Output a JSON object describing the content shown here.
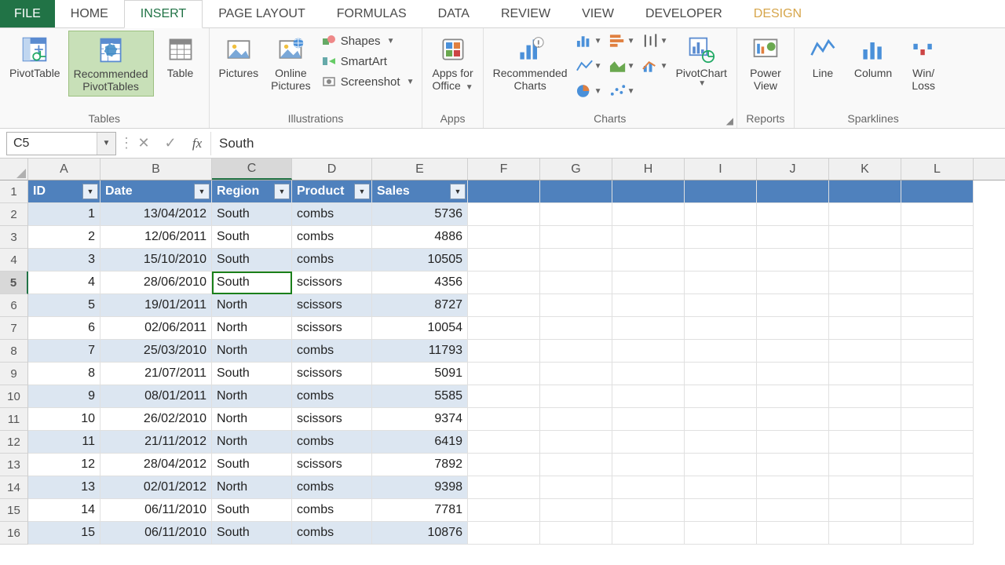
{
  "tabs": {
    "file": "FILE",
    "home": "HOME",
    "insert": "INSERT",
    "page_layout": "PAGE LAYOUT",
    "formulas": "FORMULAS",
    "data": "DATA",
    "review": "REVIEW",
    "view": "VIEW",
    "developer": "DEVELOPER",
    "design": "DESIGN"
  },
  "ribbon": {
    "tables": {
      "label": "Tables",
      "pivottable": "PivotTable",
      "recommended_pt_l1": "Recommended",
      "recommended_pt_l2": "PivotTables",
      "table": "Table"
    },
    "illustrations": {
      "label": "Illustrations",
      "pictures": "Pictures",
      "online_pictures_l1": "Online",
      "online_pictures_l2": "Pictures",
      "shapes": "Shapes",
      "smartart": "SmartArt",
      "screenshot": "Screenshot"
    },
    "apps": {
      "label": "Apps",
      "apps_for_office_l1": "Apps for",
      "apps_for_office_l2": "Office"
    },
    "charts": {
      "label": "Charts",
      "recommended_l1": "Recommended",
      "recommended_l2": "Charts",
      "pivotchart": "PivotChart"
    },
    "reports": {
      "label": "Reports",
      "power_view_l1": "Power",
      "power_view_l2": "View"
    },
    "sparklines": {
      "label": "Sparklines",
      "line": "Line",
      "column": "Column",
      "winloss_l1": "Win/",
      "winloss_l2": "Loss"
    }
  },
  "formula_bar": {
    "namebox": "C5",
    "value": "South"
  },
  "grid": {
    "columns": [
      "A",
      "B",
      "C",
      "D",
      "E",
      "F",
      "G",
      "H",
      "I",
      "J",
      "K",
      "L"
    ],
    "selected_col": "C",
    "selected_row": 5,
    "widths": [
      "cA",
      "cB",
      "cC",
      "cD",
      "cE",
      "cF",
      "cG",
      "cH",
      "cI",
      "cJ",
      "cK",
      "cL"
    ],
    "table_cols": 5,
    "headers": [
      "ID",
      "Date",
      "Region",
      "Product",
      "Sales"
    ],
    "rows": [
      {
        "n": 1,
        "hdr": true
      },
      {
        "n": 2,
        "band": true,
        "cells": [
          "1",
          "13/04/2012",
          "South",
          "combs",
          "5736"
        ]
      },
      {
        "n": 3,
        "band": false,
        "cells": [
          "2",
          "12/06/2011",
          "South",
          "combs",
          "4886"
        ]
      },
      {
        "n": 4,
        "band": true,
        "cells": [
          "3",
          "15/10/2010",
          "South",
          "combs",
          "10505"
        ]
      },
      {
        "n": 5,
        "band": false,
        "cells": [
          "4",
          "28/06/2010",
          "South",
          "scissors",
          "4356"
        ],
        "sel_col": 2
      },
      {
        "n": 6,
        "band": true,
        "cells": [
          "5",
          "19/01/2011",
          "North",
          "scissors",
          "8727"
        ]
      },
      {
        "n": 7,
        "band": false,
        "cells": [
          "6",
          "02/06/2011",
          "North",
          "scissors",
          "10054"
        ]
      },
      {
        "n": 8,
        "band": true,
        "cells": [
          "7",
          "25/03/2010",
          "North",
          "combs",
          "11793"
        ]
      },
      {
        "n": 9,
        "band": false,
        "cells": [
          "8",
          "21/07/2011",
          "South",
          "scissors",
          "5091"
        ]
      },
      {
        "n": 10,
        "band": true,
        "cells": [
          "9",
          "08/01/2011",
          "North",
          "combs",
          "5585"
        ]
      },
      {
        "n": 11,
        "band": false,
        "cells": [
          "10",
          "26/02/2010",
          "North",
          "scissors",
          "9374"
        ]
      },
      {
        "n": 12,
        "band": true,
        "cells": [
          "11",
          "21/11/2012",
          "North",
          "combs",
          "6419"
        ]
      },
      {
        "n": 13,
        "band": false,
        "cells": [
          "12",
          "28/04/2012",
          "South",
          "scissors",
          "7892"
        ]
      },
      {
        "n": 14,
        "band": true,
        "cells": [
          "13",
          "02/01/2012",
          "North",
          "combs",
          "9398"
        ]
      },
      {
        "n": 15,
        "band": false,
        "cells": [
          "14",
          "06/11/2010",
          "South",
          "combs",
          "7781"
        ]
      },
      {
        "n": 16,
        "band": true,
        "cells": [
          "15",
          "06/11/2010",
          "South",
          "combs",
          "10876"
        ]
      }
    ],
    "num_cols": [
      0,
      4
    ],
    "right_cols": [
      1
    ]
  }
}
